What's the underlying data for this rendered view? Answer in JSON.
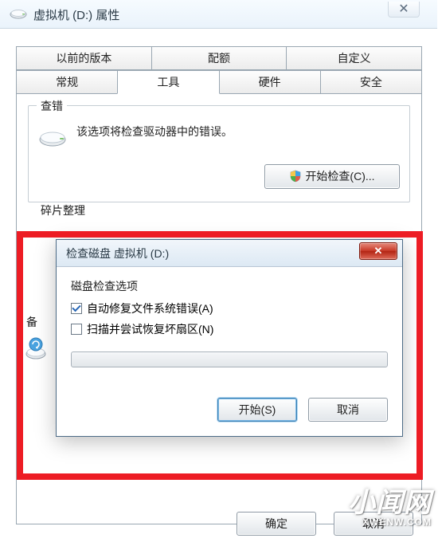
{
  "window": {
    "title": "虚拟机 (D:) 属性",
    "close_glyph": "✕"
  },
  "tabs": {
    "row1": [
      "以前的版本",
      "配额",
      "自定义"
    ],
    "row2": [
      "常规",
      "工具",
      "硬件",
      "安全"
    ],
    "active": "工具"
  },
  "error_check": {
    "legend": "查错",
    "desc": "该选项将检查驱动器中的错误。",
    "button": "开始检查(C)..."
  },
  "defrag": {
    "legend": "碎片整理"
  },
  "backup": {
    "legend": "备"
  },
  "child": {
    "title": "检查磁盘 虚拟机 (D:)",
    "close_glyph": "✕",
    "group_label": "磁盘检查选项",
    "opt1_label": "自动修复文件系统错误(A)",
    "opt1_checked": true,
    "opt2_label": "扫描并尝试恢复坏扇区(N)",
    "opt2_checked": false,
    "start_label": "开始(S)",
    "cancel_label": "取消"
  },
  "parent_buttons": {
    "ok": "确定",
    "cancel": "取消"
  },
  "watermark": {
    "big": "小闻网",
    "small": "XWENW.COM"
  },
  "colors": {
    "highlight": "#ed1c24",
    "close_red": "#c83a29",
    "accent_blue": "#3c7fb1"
  }
}
